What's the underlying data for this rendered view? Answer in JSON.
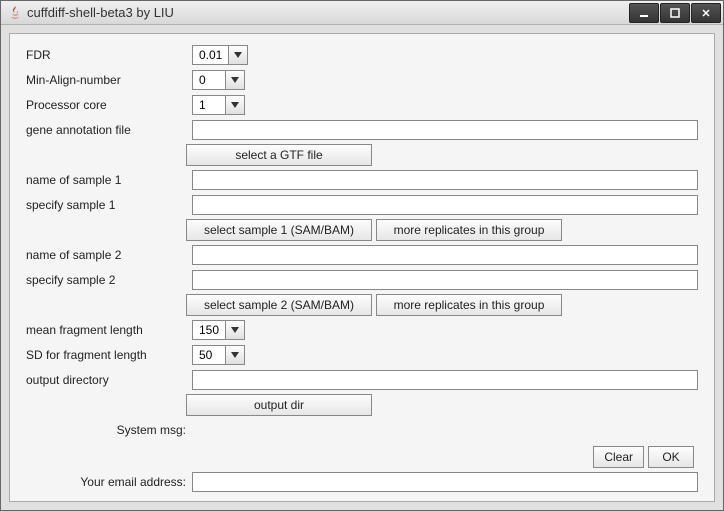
{
  "window": {
    "title": "cuffdiff-shell-beta3 by LIU"
  },
  "labels": {
    "fdr": "FDR",
    "min_align": "Min-Align-number",
    "processor": "Processor core",
    "gene_annot": "gene annotation file",
    "sample1_name": "name of sample 1",
    "sample1_spec": "specify sample 1",
    "sample2_name": "name of sample 2",
    "sample2_spec": "specify sample 2",
    "mean_frag": "mean fragment length",
    "sd_frag": "SD for fragment length",
    "output_dir": "output directory",
    "system_msg": "System msg:",
    "email": "Your email address:"
  },
  "values": {
    "fdr": "0.01",
    "min_align": "0",
    "processor": "1",
    "gene_annot": "",
    "sample1_name": "",
    "sample1_spec": "",
    "sample2_name": "",
    "sample2_spec": "",
    "mean_frag": "150",
    "sd_frag": "50",
    "output_dir": "",
    "email": ""
  },
  "buttons": {
    "select_gtf": "select a GTF file",
    "select_sample1": "select sample 1 (SAM/BAM)",
    "more_rep1": "more replicates in this group",
    "select_sample2": "select sample 2 (SAM/BAM)",
    "more_rep2": "more replicates in this group",
    "output_dir": "output dir",
    "clear": "Clear",
    "ok": "OK"
  }
}
